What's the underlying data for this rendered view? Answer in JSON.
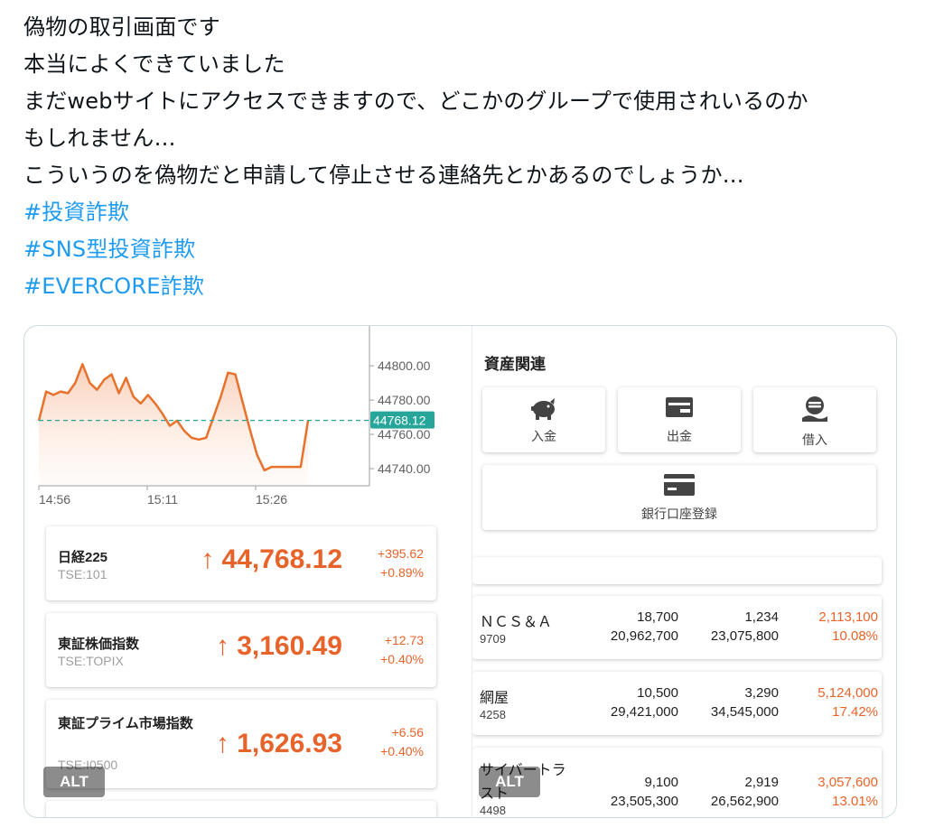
{
  "post": {
    "lines": [
      "偽物の取引画面です",
      "本当によくできていました",
      "まだwebサイトにアクセスできますので、どこかのグループで使用されいるのか",
      "もしれません…",
      "こういうのを偽物だと申請して停止させる連絡先とかあるのでしょうか…"
    ],
    "hashtags": [
      "#投資詐欺",
      "#SNS型投資詐欺",
      "#EVERCORE詐欺"
    ]
  },
  "chart_data": {
    "type": "area",
    "title": "",
    "x_ticks": [
      "14:56",
      "15:11",
      "15:26"
    ],
    "y_ticks": [
      "44800.00",
      "44780.00",
      "44760.00",
      "44740.00"
    ],
    "ylim": [
      44730,
      44818
    ],
    "current_label": "44768.12",
    "current_value": 44768.12,
    "series": [
      {
        "values": [
          44768,
          44785,
          44783,
          44785,
          44784,
          44790,
          44801,
          44790,
          44786,
          44792,
          44795,
          44784,
          44793,
          44782,
          44778,
          44783,
          44778,
          44772,
          44765,
          44768,
          44762,
          44758,
          44757,
          44758,
          44770,
          44782,
          44796,
          44795,
          44779,
          44763,
          44748,
          44739,
          44741,
          44741,
          44741,
          44741,
          44741,
          44768
        ]
      }
    ],
    "colors": {
      "line": "#e8712c",
      "baseline": "#26a69a",
      "label_bg": "#26a69a"
    }
  },
  "indices": [
    {
      "name": "日経225",
      "code": "TSE:101",
      "value": "↑ 44,768.12",
      "change": "+395.62",
      "change_pct": "+0.89%"
    },
    {
      "name": "東証株価指数",
      "code": "TSE:TOPIX",
      "value": "↑ 3,160.49",
      "change": "+12.73",
      "change_pct": "+0.40%"
    },
    {
      "name": "東証プライム市場指数",
      "code": "TSE:I0500",
      "value": "↑ 1,626.93",
      "change": "+6.56",
      "change_pct": "+0.40%"
    }
  ],
  "assets": {
    "title": "資産関連",
    "buttons": [
      {
        "label": "入金",
        "icon": "piggy-bank-icon"
      },
      {
        "label": "出金",
        "icon": "wallet-icon"
      },
      {
        "label": "借入",
        "icon": "coin-stack-hand-icon"
      },
      {
        "label": "銀行口座登録",
        "icon": "credit-card-icon"
      }
    ]
  },
  "stocks": [
    {
      "name": "ＮＣＳ＆Ａ",
      "code": "9709",
      "c1": "18,700",
      "c1b": "20,962,700",
      "c2": "1,234",
      "c2b": "23,075,800",
      "c3": "2,113,100",
      "c3b": "10.08%"
    },
    {
      "name": "網屋",
      "code": "4258",
      "c1": "10,500",
      "c1b": "29,421,000",
      "c2": "3,290",
      "c2b": "34,545,000",
      "c3": "5,124,000",
      "c3b": "17.42%"
    },
    {
      "name": "サイバートラスト",
      "code": "4498",
      "c1": "9,100",
      "c1b": "23,505,300",
      "c2": "2,919",
      "c2b": "26,562,900",
      "c3": "3,057,600",
      "c3b": "13.01%"
    }
  ],
  "alt_badge": "ALT",
  "colors": {
    "accent": "#e8632a",
    "hashtag": "#1d9bf0",
    "teal": "#26a69a"
  }
}
